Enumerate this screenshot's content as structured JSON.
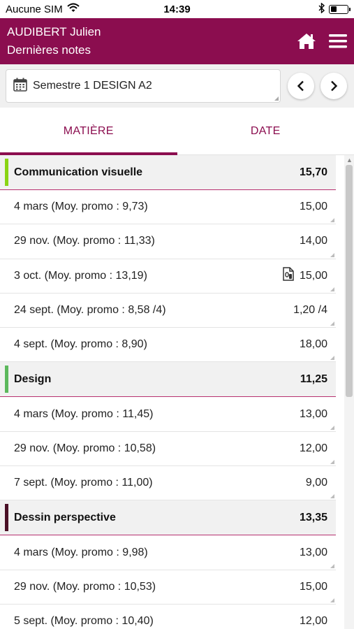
{
  "status_bar": {
    "carrier": "Aucune SIM",
    "time": "14:39"
  },
  "header": {
    "name": "AUDIBERT Julien",
    "subtitle": "Dernières notes"
  },
  "period": {
    "label": "Semestre 1 DESIGN A2"
  },
  "tabs": [
    {
      "label": "MATIÈRE",
      "active": true
    },
    {
      "label": "DATE",
      "active": false
    }
  ],
  "colors": {
    "brand": "#8b0d4f",
    "accent_green": "#8ad414",
    "accent_mid_green": "#5cb85c",
    "accent_dark": "#4a1026"
  },
  "groups": [
    {
      "name": "Communication visuelle",
      "average": "15,70",
      "color": "#8ad414",
      "notes": [
        {
          "label": "4 mars (Moy. promo : 9,73)",
          "value": "15,00"
        },
        {
          "label": "29 nov. (Moy. promo : 11,33)",
          "value": "14,00"
        },
        {
          "label": "3 oct. (Moy. promo : 13,19)",
          "value": "15,00",
          "icon": "document-clip-icon"
        },
        {
          "label": "24 sept. (Moy. promo : 8,58 /4)",
          "value": "1,20 /4"
        },
        {
          "label": "4 sept. (Moy. promo : 8,90)",
          "value": "18,00"
        }
      ]
    },
    {
      "name": "Design",
      "average": "11,25",
      "color": "#5cb85c",
      "notes": [
        {
          "label": "4 mars (Moy. promo : 11,45)",
          "value": "13,00"
        },
        {
          "label": "29 nov. (Moy. promo : 10,58)",
          "value": "12,00"
        },
        {
          "label": "7 sept. (Moy. promo : 11,00)",
          "value": "9,00"
        }
      ]
    },
    {
      "name": "Dessin perspective",
      "average": "13,35",
      "color": "#4a1026",
      "notes": [
        {
          "label": "4 mars (Moy. promo : 9,98)",
          "value": "13,00"
        },
        {
          "label": "29 nov. (Moy. promo : 10,53)",
          "value": "15,00"
        },
        {
          "label": "5 sept. (Moy. promo : 10,40)",
          "value": "12,00"
        }
      ]
    }
  ]
}
